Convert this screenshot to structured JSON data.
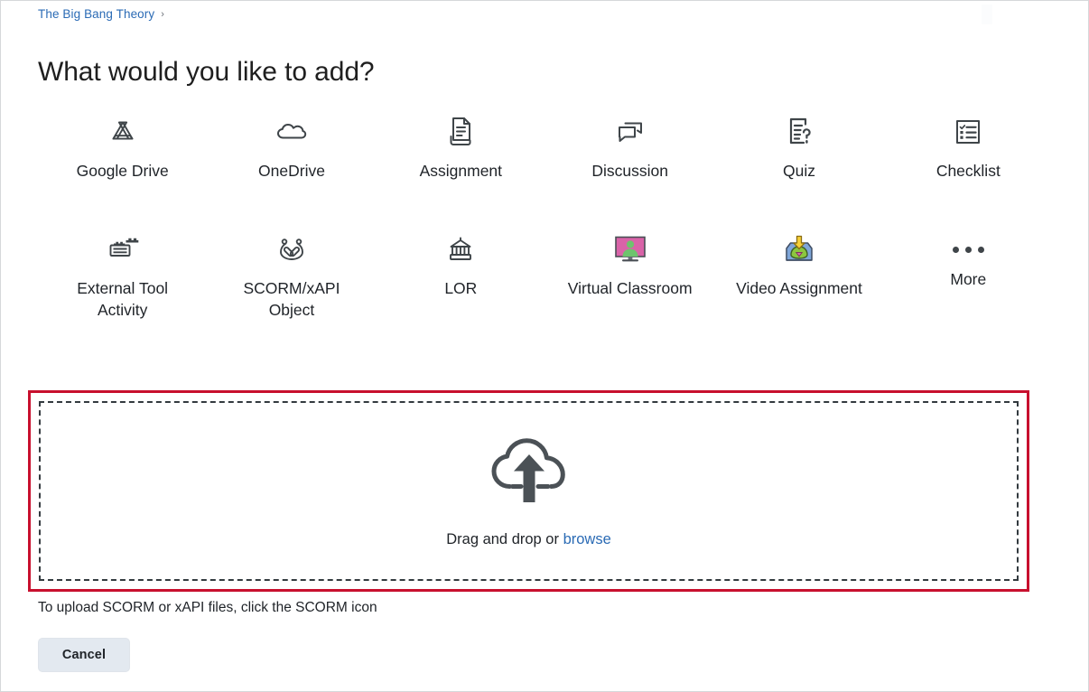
{
  "breadcrumb": {
    "link_label": "The Big Bang Theory",
    "separator": "›"
  },
  "page_title": "What would you like to add?",
  "tools": [
    {
      "label": "Google Drive",
      "icon": "google-drive-icon"
    },
    {
      "label": "OneDrive",
      "icon": "onedrive-cloud-icon"
    },
    {
      "label": "Assignment",
      "icon": "assignment-document-icon"
    },
    {
      "label": "Discussion",
      "icon": "discussion-speech-bubbles-icon"
    },
    {
      "label": "Quiz",
      "icon": "quiz-question-document-icon"
    },
    {
      "label": "Checklist",
      "icon": "checklist-icon"
    },
    {
      "label": "External Tool Activity",
      "icon": "external-tool-lego-brick-icon"
    },
    {
      "label": "SCORM/xAPI Object",
      "icon": "scorm-xapi-icon"
    },
    {
      "label": "LOR",
      "icon": "lor-bank-building-icon"
    },
    {
      "label": "Virtual Classroom",
      "icon": "virtual-classroom-monitor-icon"
    },
    {
      "label": "Video Assignment",
      "icon": "video-assignment-inbox-icon"
    },
    {
      "label": "More",
      "icon": "more-ellipsis-icon"
    }
  ],
  "dropzone": {
    "icon": "cloud-upload-icon",
    "prompt_prefix": "Drag and drop or ",
    "browse_label": "browse"
  },
  "hint": "To upload SCORM or xAPI files, click the SCORM icon",
  "cancel_label": "Cancel",
  "colors": {
    "link": "#2b6bb5",
    "highlight_border": "#c8102e",
    "icon_gray": "#3f4549",
    "text": "#1f2328",
    "cancel_bg": "#e3e9f0",
    "virtual_classroom_screen": "#d963a8",
    "virtual_classroom_person": "#6dc36d",
    "video_assignment_tray": "#7fa6d9",
    "video_assignment_arrow": "#f7d038",
    "video_assignment_shape": "#8cc63f"
  }
}
